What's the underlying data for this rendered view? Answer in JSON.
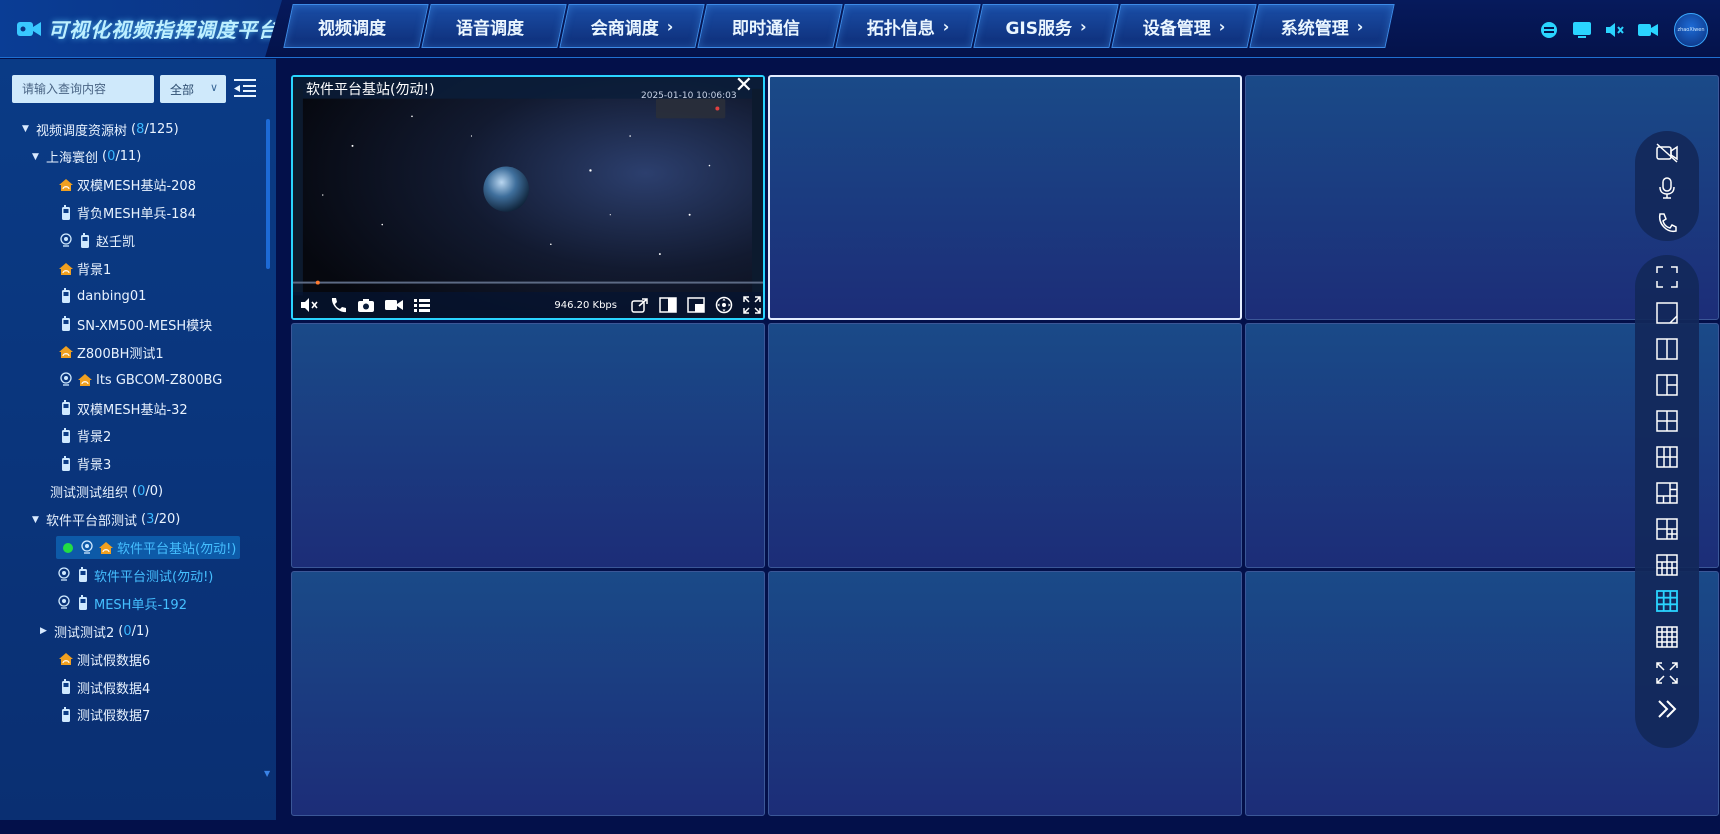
{
  "app": {
    "title": "可视化视频指挥调度平台"
  },
  "nav": [
    {
      "label": "视频调度",
      "chevron": ""
    },
    {
      "label": "语音调度",
      "chevron": ""
    },
    {
      "label": "会商调度",
      "chevron": "›"
    },
    {
      "label": "即时通信",
      "chevron": ""
    },
    {
      "label": "拓扑信息",
      "chevron": "›"
    },
    {
      "label": "GIS服务",
      "chevron": "›"
    },
    {
      "label": "设备管理",
      "chevron": "›"
    },
    {
      "label": "系统管理",
      "chevron": "›"
    }
  ],
  "header_icons": [
    "message-icon",
    "screen-icon",
    "mute-speaker-icon",
    "camera-icon"
  ],
  "avatar_text": "zhaoXiwen",
  "sidebar": {
    "search_placeholder": "请输入查询内容",
    "filter_value": "全部",
    "tree": [
      {
        "label": "视频调度资源树",
        "count_online": "8",
        "count_total": "/125)",
        "open": "(",
        "type": "group",
        "expanded": true
      },
      {
        "label": "上海寰创",
        "count_online": "0",
        "count_total": "/11)",
        "open": "(",
        "type": "group",
        "expanded": true
      },
      {
        "label": "双模MESH基站-208",
        "type": "device",
        "icons": [
          "base-station-icon"
        ]
      },
      {
        "label": "背负MESH单兵-184",
        "type": "device",
        "icons": [
          "radio-icon"
        ]
      },
      {
        "label": "赵壬凯",
        "type": "device",
        "icons": [
          "locate-icon",
          "radio-icon"
        ]
      },
      {
        "label": "背景1",
        "type": "device",
        "icons": [
          "base-station-icon"
        ]
      },
      {
        "label": "danbing01",
        "type": "device",
        "icons": [
          "radio-icon"
        ]
      },
      {
        "label": "SN-XM500-MESH模块",
        "type": "device",
        "icons": [
          "radio-icon"
        ]
      },
      {
        "label": "Z800BH测试1",
        "type": "device",
        "icons": [
          "base-station-icon"
        ]
      },
      {
        "label": "Its GBCOM-Z800BG",
        "type": "device",
        "icons": [
          "locate-icon",
          "base-station-icon"
        ]
      },
      {
        "label": "双模MESH基站-32",
        "type": "device",
        "icons": [
          "radio-icon"
        ]
      },
      {
        "label": "背景2",
        "type": "device",
        "icons": [
          "radio-icon"
        ]
      },
      {
        "label": "背景3",
        "type": "device",
        "icons": [
          "radio-icon"
        ]
      },
      {
        "label": "测试测试组织",
        "count_online": "0",
        "count_total": "/0)",
        "open": "(",
        "type": "group-leaf"
      },
      {
        "label": "软件平台部测试",
        "count_online": "3",
        "count_total": "/20)",
        "open": "(",
        "type": "group",
        "expanded": true
      },
      {
        "label": "软件平台基站(勿动!)",
        "type": "device",
        "icons": [
          "online-dot",
          "locate-icon",
          "base-station-icon"
        ],
        "active": true,
        "selected": true
      },
      {
        "label": "软件平台测试(勿动!)",
        "type": "device",
        "icons": [
          "locate-icon",
          "radio-icon"
        ],
        "active": true
      },
      {
        "label": "MESH单兵-192",
        "type": "device",
        "icons": [
          "locate-icon",
          "radio-icon"
        ],
        "active": true
      },
      {
        "label": "测试测试2",
        "count_online": "0",
        "count_total": "/1)",
        "open": "(",
        "type": "group",
        "expanded": false
      },
      {
        "label": "测试假数据6",
        "type": "device",
        "icons": [
          "base-station-icon"
        ]
      },
      {
        "label": "测试假数据4",
        "type": "device",
        "icons": [
          "radio-icon"
        ]
      },
      {
        "label": "测试假数据7",
        "type": "device",
        "icons": [
          "radio-icon"
        ]
      }
    ]
  },
  "video": {
    "title": "软件平台基站(勿动!)",
    "close": "✕",
    "timestamp": "2025-01-10 10:06:03",
    "bitrate": "946.20 Kbps"
  },
  "colors": {
    "accent": "#2ad4ff",
    "online": "#22dd44",
    "station": "#f0a020",
    "radio": "#cfe9ff"
  },
  "right_toolbar": {
    "group1": [
      "camera-off-icon",
      "microphone-icon",
      "phone-icon"
    ],
    "group2": [
      "fullscreen-frame-icon",
      "layout-1-icon",
      "layout-2-icon",
      "layout-3-icon",
      "layout-4-icon",
      "layout-6-icon",
      "layout-8-icon",
      "layout-7-icon",
      "layout-9b-icon",
      "layout-9-icon",
      "layout-16-icon",
      "expand-icon",
      "double-chevron-right-icon"
    ]
  }
}
